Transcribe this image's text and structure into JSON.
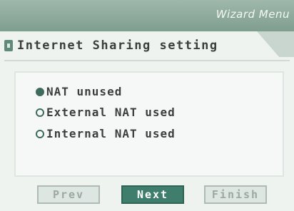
{
  "window": {
    "title": "Wizard Menu"
  },
  "section": {
    "title": "Internet Sharing setting"
  },
  "options": [
    {
      "label": "NAT unused",
      "selected": true
    },
    {
      "label": "External NAT used",
      "selected": false
    },
    {
      "label": "Internal NAT used",
      "selected": false
    }
  ],
  "buttons": {
    "prev": "Prev",
    "next": "Next",
    "finish": "Finish"
  },
  "colors": {
    "titlebar": "#7f9e90",
    "accent": "#3f7e6c",
    "text": "#3a3f3c"
  }
}
